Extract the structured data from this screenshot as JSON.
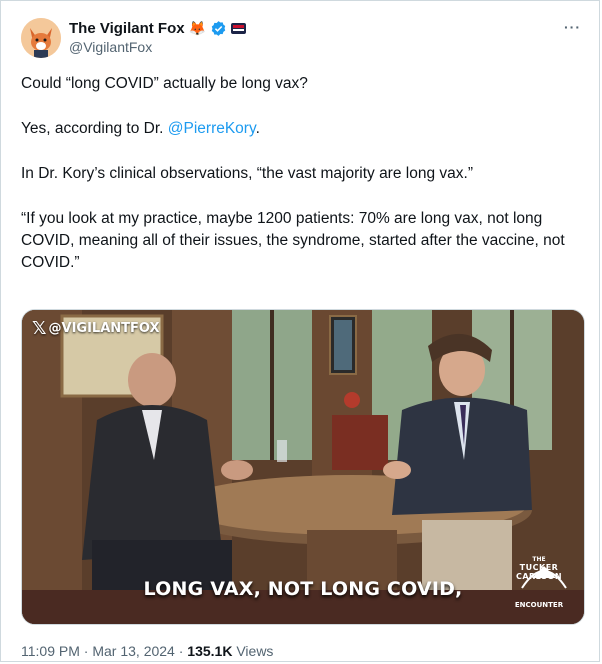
{
  "author": {
    "display_name": "The Vigilant Fox",
    "emoji": "🦊",
    "handle": "@VigilantFox",
    "verified": true
  },
  "tweet": {
    "paragraphs": [
      {
        "text": "Could “long COVID” actually be long vax?"
      },
      {
        "before": "Yes, according to Dr. ",
        "mention": "@PierreKory",
        "after": "."
      },
      {
        "text": "In Dr. Kory’s clinical observations, “the vast majority are long vax.”"
      },
      {
        "text": "“If you look at my practice, maybe 1200 patients: 70% are long vax, not long COVID, meaning all of their issues, the syndrome, started after the vaccine, not COVID.”"
      }
    ]
  },
  "media": {
    "watermark": "@VIGILANTFOX",
    "caption": "LONG VAX, NOT LONG COVID,",
    "show_logo": {
      "line1": "THE",
      "line2": "TUCKER CARLSON",
      "line3": "ENCOUNTER"
    }
  },
  "meta": {
    "time": "11:09 PM",
    "date": "Mar 13, 2024",
    "views_count": "135.1K",
    "views_label": "Views",
    "separator": "·"
  },
  "more_icon": "···",
  "colors": {
    "link": "#1d9bf0",
    "verified": "#1d9bf0",
    "muted": "#536471"
  }
}
